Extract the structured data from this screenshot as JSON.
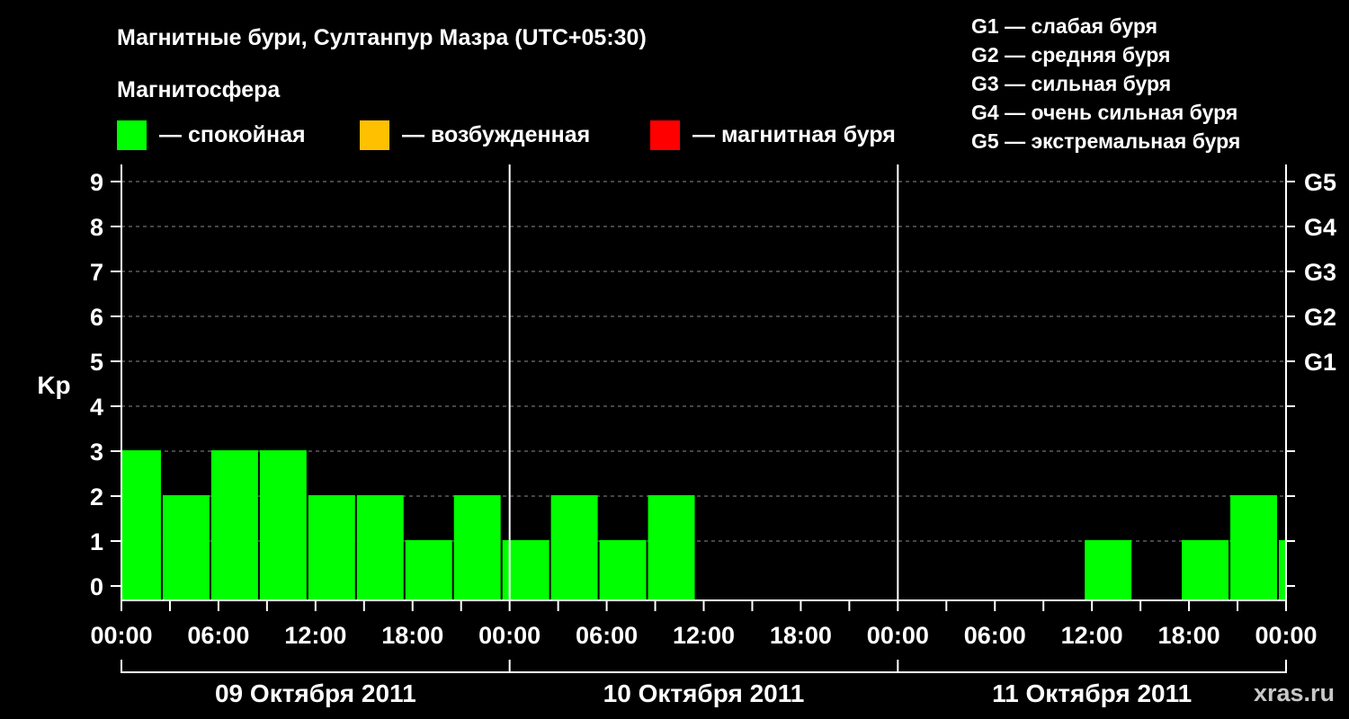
{
  "chart_data": {
    "type": "bar",
    "title": "Магнитные бури, Султанпур Мазра (UTC+05:30)",
    "section_label": "Магнитосфера",
    "legend_status": [
      {
        "label": "— спокойная",
        "color": "#00ff00"
      },
      {
        "label": "— возбужденная",
        "color": "#ffc000"
      },
      {
        "label": "— магнитная буря",
        "color": "#ff0000"
      }
    ],
    "legend_storm_levels": [
      "G1 — слабая буря",
      "G2 — средняя буря",
      "G3 — сильная буря",
      "G4 — очень сильная буря",
      "G5 — экстремальная буря"
    ],
    "ylabel": "Kp",
    "ylim": [
      0,
      9
    ],
    "y_ticks": [
      "0",
      "1",
      "2",
      "3",
      "4",
      "5",
      "6",
      "7",
      "8",
      "9"
    ],
    "g_levels": [
      {
        "label": "G1",
        "kp": 5
      },
      {
        "label": "G2",
        "kp": 6
      },
      {
        "label": "G3",
        "kp": 7
      },
      {
        "label": "G4",
        "kp": 8
      },
      {
        "label": "G5",
        "kp": 9
      }
    ],
    "x_ticks": [
      "00:00",
      "06:00",
      "12:00",
      "18:00",
      "00:00",
      "06:00",
      "12:00",
      "18:00",
      "00:00",
      "06:00",
      "12:00",
      "18:00",
      "00:00"
    ],
    "days": [
      "09 Октября 2011",
      "10 Октября 2011",
      "11 Октября 2011"
    ],
    "grid": true,
    "bars": [
      {
        "start": "2011-10-09 00:00",
        "end": "2011-10-09 02:30",
        "kp": 3
      },
      {
        "start": "2011-10-09 02:30",
        "end": "2011-10-09 05:30",
        "kp": 2
      },
      {
        "start": "2011-10-09 05:30",
        "end": "2011-10-09 08:30",
        "kp": 3
      },
      {
        "start": "2011-10-09 08:30",
        "end": "2011-10-09 11:30",
        "kp": 3
      },
      {
        "start": "2011-10-09 11:30",
        "end": "2011-10-09 14:30",
        "kp": 2
      },
      {
        "start": "2011-10-09 14:30",
        "end": "2011-10-09 17:30",
        "kp": 2
      },
      {
        "start": "2011-10-09 17:30",
        "end": "2011-10-09 20:30",
        "kp": 1
      },
      {
        "start": "2011-10-09 20:30",
        "end": "2011-10-09 23:30",
        "kp": 2
      },
      {
        "start": "2011-10-09 23:30",
        "end": "2011-10-10 02:30",
        "kp": 1
      },
      {
        "start": "2011-10-10 02:30",
        "end": "2011-10-10 05:30",
        "kp": 2
      },
      {
        "start": "2011-10-10 05:30",
        "end": "2011-10-10 08:30",
        "kp": 1
      },
      {
        "start": "2011-10-10 08:30",
        "end": "2011-10-10 11:30",
        "kp": 2
      },
      {
        "start": "2011-10-11 11:30",
        "end": "2011-10-11 14:30",
        "kp": 1
      },
      {
        "start": "2011-10-11 17:30",
        "end": "2011-10-11 20:30",
        "kp": 1
      },
      {
        "start": "2011-10-11 20:30",
        "end": "2011-10-11 23:30",
        "kp": 2
      },
      {
        "start": "2011-10-11 23:30",
        "end": "2011-10-12 00:00",
        "kp": 1
      }
    ],
    "bar_color": "#00ff00",
    "x_start": "2011-10-09 00:00",
    "x_end": "2011-10-12 00:00"
  },
  "watermark": "xras.ru"
}
